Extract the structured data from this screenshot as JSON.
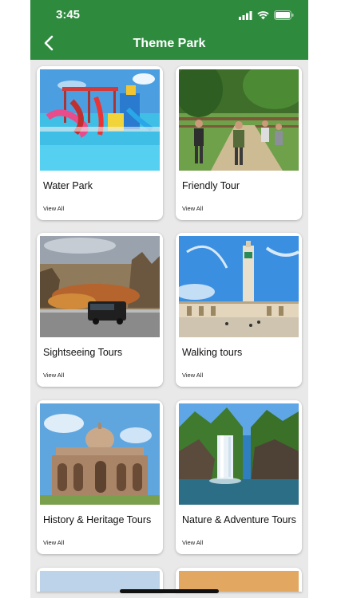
{
  "status_bar": {
    "time": "3:45"
  },
  "header": {
    "title": "Theme Park",
    "bg_color": "#2e8b3e",
    "back_icon": "chevron-left-icon"
  },
  "cards": [
    {
      "title": "Water Park",
      "link": "View All"
    },
    {
      "title": "Friendly Tour",
      "link": "View All"
    },
    {
      "title": "Sightseeing Tours",
      "link": "View All"
    },
    {
      "title": "Walking tours",
      "link": "View All"
    },
    {
      "title": "History & Heritage Tours",
      "link": "View All"
    },
    {
      "title": "Nature & Adventure Tours",
      "link": "View All"
    }
  ]
}
